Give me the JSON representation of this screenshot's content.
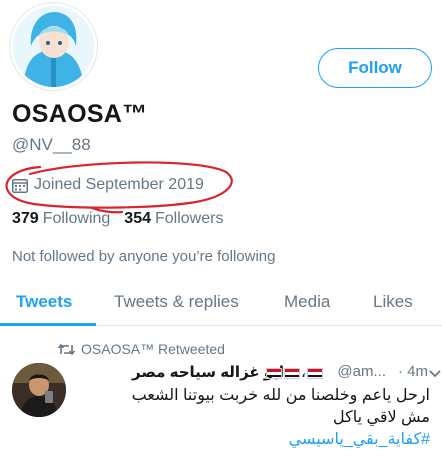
{
  "profile": {
    "display_name": "OSAOSA™",
    "handle": "@NV__88",
    "joined": "Joined September 2019",
    "following_count": "379",
    "following_label": "Following",
    "followers_count": "354",
    "followers_label": "Followers",
    "not_followed_text": "Not followed by anyone you’re following"
  },
  "actions": {
    "follow_label": "Follow"
  },
  "tabs": [
    {
      "label": "Tweets",
      "active": true
    },
    {
      "label": "Tweets & replies",
      "active": false
    },
    {
      "label": "Media",
      "active": false
    },
    {
      "label": "Likes",
      "active": false
    }
  ],
  "tweet": {
    "retweet_label": "OSAOSA™ Retweeted",
    "author_name": "ابو غزاله سياحه مصر",
    "author_handle": "@am...",
    "time": "· 4m",
    "text_line1": "ارحل ياعم وخلصنا من لله خربت بيوتنا الشعب",
    "text_line2": "مش لاقي ياكل",
    "hashtag": "#كفاية_بقي_ياسيسي"
  },
  "colors": {
    "accent": "#1da1f2",
    "muted_text": "#657786",
    "annotation_red": "#d9232d"
  },
  "icons": {
    "calendar": "calendar-icon",
    "retweet": "retweet-icon",
    "caret": "chevron-down-icon"
  }
}
